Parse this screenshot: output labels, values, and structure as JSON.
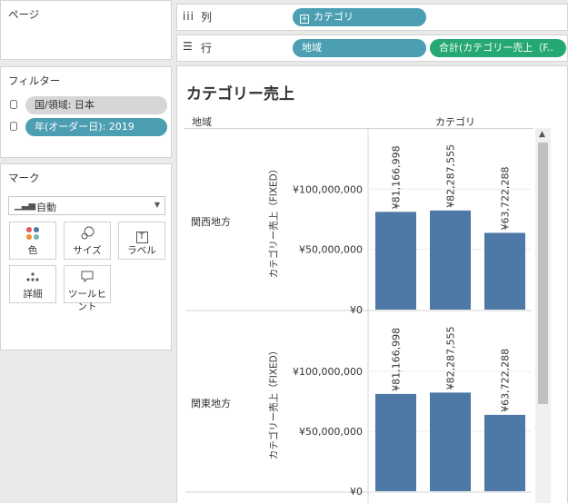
{
  "pages_panel": {
    "title": "ページ"
  },
  "filters_panel": {
    "title": "フィルター",
    "items": [
      {
        "label": "国/領域: 日本"
      },
      {
        "label": "年(オーダー日): 2019"
      }
    ]
  },
  "marks_panel": {
    "title": "マーク",
    "mark_type": "自動",
    "buttons": [
      {
        "label": "色"
      },
      {
        "label": "サイズ"
      },
      {
        "label": "ラベル"
      },
      {
        "label": "詳細"
      },
      {
        "label": "ツールヒント"
      }
    ]
  },
  "columns_shelf": {
    "label": "列",
    "pills": [
      {
        "label": "カテゴリ"
      }
    ]
  },
  "rows_shelf": {
    "label": "行",
    "pills": [
      {
        "label": "地域"
      },
      {
        "label": "合計(カテゴリー売上（F.."
      }
    ]
  },
  "view": {
    "title": "カテゴリー売上",
    "row_field": "地域",
    "column_field": "カテゴリ"
  },
  "chart_data": {
    "type": "bar",
    "categories": [
      "",
      "",
      ""
    ],
    "rows": [
      {
        "name": "関西地方",
        "values": [
          81166998,
          82287555,
          63722288
        ]
      },
      {
        "name": "関東地方",
        "values": [
          81166998,
          82287555,
          63722288
        ]
      }
    ],
    "value_labels": [
      "¥81,166,998",
      "¥82,287,555",
      "¥63,722,288"
    ],
    "ylabel": "カテゴリー売上（FIXED）",
    "yticks": [
      {
        "value": 0,
        "label": "¥0"
      },
      {
        "value": 50000000,
        "label": "¥50,000,000"
      },
      {
        "value": 100000000,
        "label": "¥100,000,000"
      }
    ],
    "bar_color": "#4e79a7"
  }
}
